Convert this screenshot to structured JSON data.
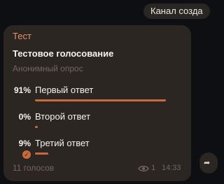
{
  "channel_pill": "Канал созда",
  "message": {
    "author": "Тест",
    "question": "Тестовое голосование",
    "poll_type": "Анонимный опрос",
    "options": [
      {
        "percent": "91%",
        "label": "Первый ответ",
        "fraction": 0.91,
        "chosen": false
      },
      {
        "percent": "0%",
        "label": "Второй ответ",
        "fraction": 0.0,
        "chosen": false
      },
      {
        "percent": "9%",
        "label": "Третий ответ",
        "fraction": 0.09,
        "chosen": true
      }
    ],
    "votes": "11 голосов",
    "views": "1",
    "time": "14:33"
  },
  "icons": {
    "views": "eye-icon",
    "check": "checkmark-icon",
    "share": "share-icon"
  },
  "colors": {
    "accent": "#c86a3c",
    "author": "#e8906a",
    "bubble": "#2b2622",
    "background": "#0e0f12"
  }
}
